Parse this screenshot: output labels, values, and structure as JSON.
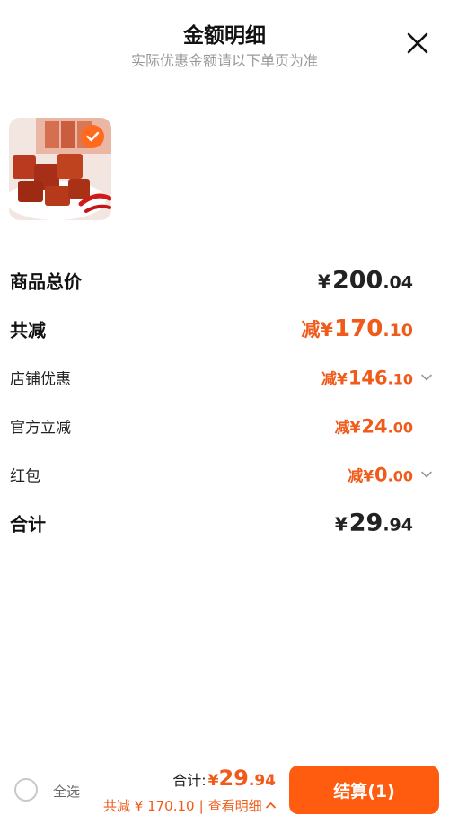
{
  "header": {
    "title": "金额明细",
    "subtitle": "实际优惠金额请以下单页为准",
    "close_icon": "close-icon"
  },
  "product": {
    "image": "spicy-dried-tofu-product-image",
    "selected": true
  },
  "summary": {
    "goods_total": {
      "label": "商品总价",
      "currency": "¥",
      "int": "200",
      "dec": ".04"
    },
    "total_discount": {
      "label": "共减",
      "prefix": "减",
      "currency": "¥",
      "int": "170",
      "dec": ".10"
    },
    "shop_discount": {
      "label": "店铺优惠",
      "prefix": "减",
      "currency": "¥",
      "int": "146",
      "dec": ".10",
      "icon": "chevron-down-icon"
    },
    "official_discount": {
      "label": "官方立减",
      "prefix": "减",
      "currency": "¥",
      "int": "24",
      "dec": ".00"
    },
    "red_packet": {
      "label": "红包",
      "prefix": "减",
      "currency": "¥",
      "int": "0",
      "dec": ".00",
      "icon": "chevron-down-icon"
    },
    "grand_total": {
      "label": "合计",
      "currency": "¥",
      "int": "29",
      "dec": ".94"
    }
  },
  "bottom_bar": {
    "select_all_label": "全选",
    "total_label": "合计:",
    "total_currency": "¥",
    "total_int": "29",
    "total_dec": ".94",
    "discount_text": "共减 ¥ 170.10",
    "separator": "|",
    "view_detail_label": "查看明细",
    "checkout_label": "结算(1)"
  },
  "colors": {
    "accent": "#f05a1a",
    "checkout_button": "#ff5c0f"
  }
}
